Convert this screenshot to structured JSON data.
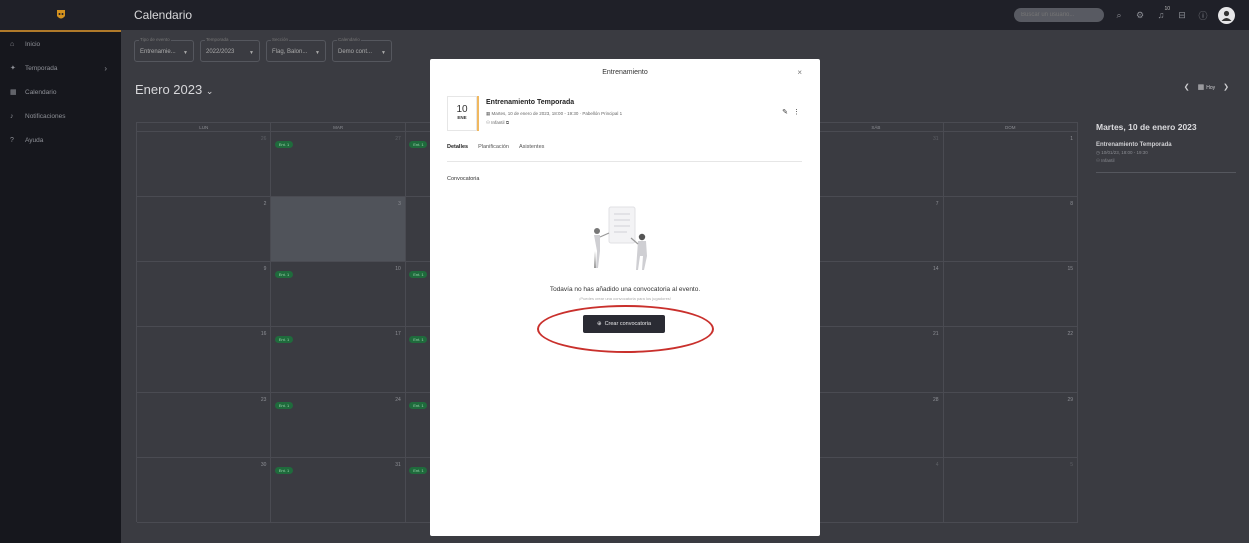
{
  "app": {
    "title": "Calendario"
  },
  "header": {
    "search_placeholder": "Buscar un usuario...",
    "notif_badge": "10"
  },
  "sidebar": {
    "items": [
      {
        "label": "Inicio",
        "icon": "home-icon",
        "glyph": "⌂"
      },
      {
        "label": "Temporada",
        "icon": "run-icon",
        "glyph": "✦",
        "has_submenu": true
      },
      {
        "label": "Calendario",
        "icon": "calendar-icon",
        "glyph": "▦"
      },
      {
        "label": "Notificaciones",
        "icon": "bell-icon",
        "glyph": "♪"
      },
      {
        "label": "Ayuda",
        "icon": "help-icon",
        "glyph": "?"
      }
    ]
  },
  "filters": [
    {
      "label": "Tipo de evento",
      "value": "Entrenamie..."
    },
    {
      "label": "Temporada",
      "value": "2022/2023"
    },
    {
      "label": "Sección",
      "value": "Flag, Balon..."
    },
    {
      "label": "Calendario",
      "value": "Demo cont..."
    }
  ],
  "calendar": {
    "month": "Enero 2023",
    "today_label": "Hoy",
    "weekday_headers": [
      "LUN",
      "MAR",
      "",
      "",
      "",
      "SÁB",
      "DOM"
    ],
    "event_badge": "Ent. 1",
    "rows": [
      [
        {
          "d": "26",
          "m": true,
          "ev": true
        },
        {
          "d": "27",
          "m": true,
          "ev": true
        },
        {
          "d": "",
          "ev": true
        },
        {
          "d": ""
        },
        {
          "d": ""
        },
        {
          "d": "31",
          "m": true
        },
        {
          "d": "1"
        }
      ],
      [
        {
          "d": "2",
          "ev": true
        },
        {
          "d": "3",
          "today": true
        },
        {
          "d": ""
        },
        {
          "d": ""
        },
        {
          "d": ""
        },
        {
          "d": "7"
        },
        {
          "d": "8"
        }
      ],
      [
        {
          "d": "9",
          "ev": true
        },
        {
          "d": "10",
          "ev": true
        },
        {
          "d": ""
        },
        {
          "d": ""
        },
        {
          "d": ""
        },
        {
          "d": "14"
        },
        {
          "d": "15"
        }
      ],
      [
        {
          "d": "16",
          "ev": true
        },
        {
          "d": "17",
          "ev": true
        },
        {
          "d": ""
        },
        {
          "d": ""
        },
        {
          "d": ""
        },
        {
          "d": "21"
        },
        {
          "d": "22"
        }
      ],
      [
        {
          "d": "23",
          "ev": true
        },
        {
          "d": "24",
          "ev": true
        },
        {
          "d": ""
        },
        {
          "d": ""
        },
        {
          "d": ""
        },
        {
          "d": "28"
        },
        {
          "d": "29"
        }
      ],
      [
        {
          "d": "30",
          "ev": true
        },
        {
          "d": "31",
          "ev": true
        },
        {
          "d": ""
        },
        {
          "d": ""
        },
        {
          "d": ""
        },
        {
          "d": "4",
          "m": true
        },
        {
          "d": "5",
          "m": true
        }
      ]
    ]
  },
  "side_panel": {
    "date": "Martes, 10 de enero 2023",
    "event_name": "Entrenamiento Temporada",
    "event_time": "10/01/23, 18:00 - 19:30",
    "event_team": "Infantil"
  },
  "modal": {
    "title": "Entrenamiento",
    "day": "10",
    "month_abbr": "ENE",
    "event_title": "Entrenamiento Temporada",
    "event_datetime": "Martes, 10 de enero de 2023, 18:00 - 19:30 · Pabellón Principal 1",
    "event_team": "Infantil",
    "tabs": [
      "Detalles",
      "Planificación",
      "Asistentes"
    ],
    "section_title": "Convocatoria",
    "empty_message": "Todavía no has añadido una convocatoria al evento.",
    "empty_sub": "¡Puedes crear una convocatoria para los jugadores!",
    "create_button": "Crear convocatoria"
  },
  "colors": {
    "accent": "#b07a2a",
    "event_green": "#1f6b3c",
    "highlight_red": "#c9302c",
    "button_dark": "#2a2b33"
  }
}
